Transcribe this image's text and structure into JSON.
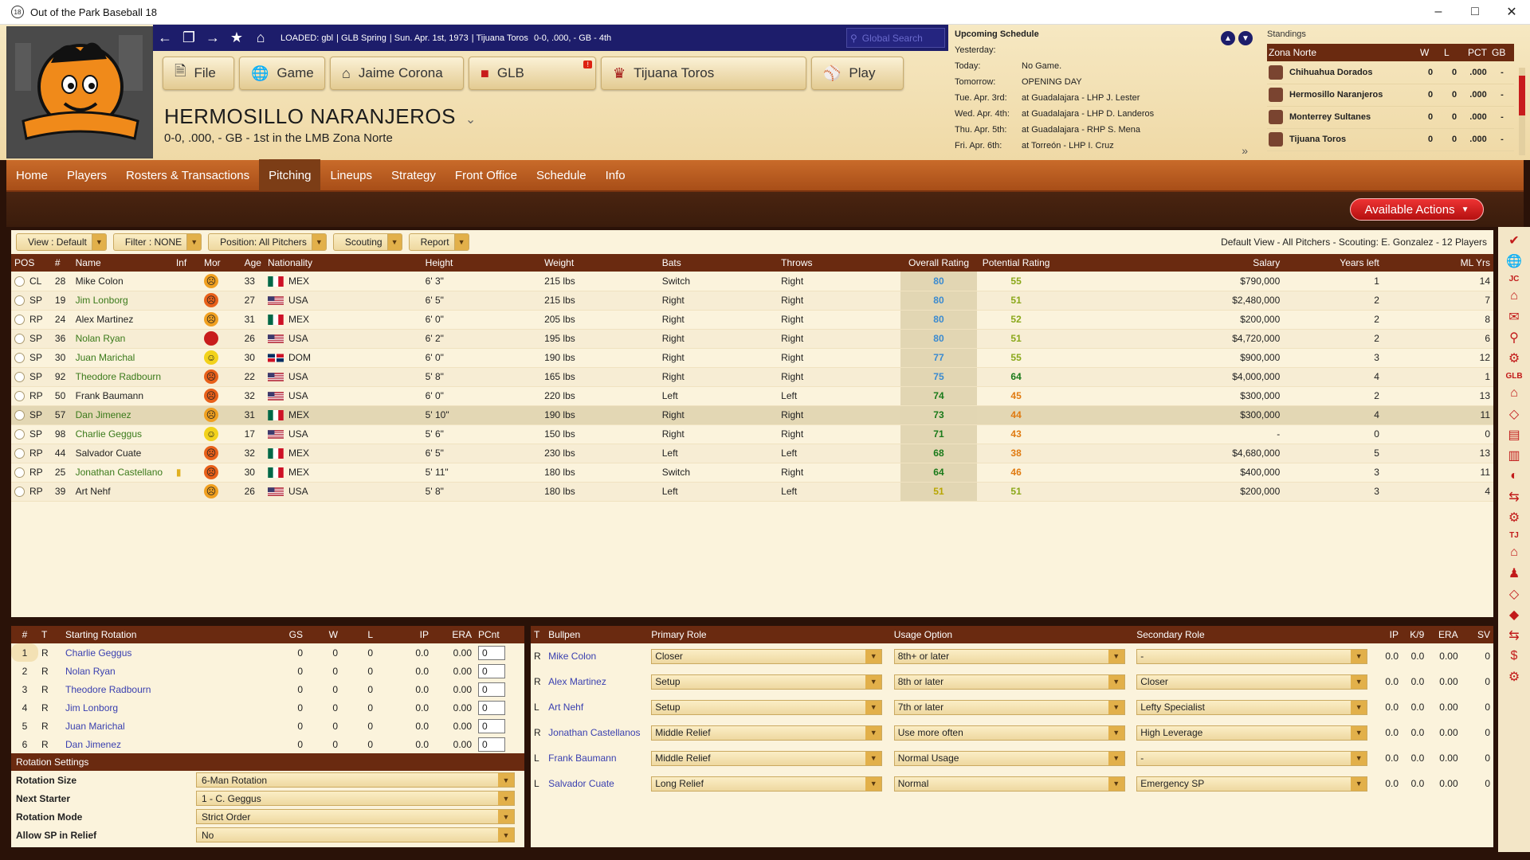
{
  "window": {
    "title": "Out of the Park Baseball 18",
    "icon_text": "18"
  },
  "navbar": {
    "loaded": "LOADED: gbl",
    "parts": [
      "GLB Spring",
      "Sun. Apr. 1st, 1973",
      "Tijuana Toros",
      "0-0, .000, - GB - 4th"
    ],
    "search_placeholder": "Global Search"
  },
  "main_menu": [
    {
      "label": "File",
      "icon": "file-icon"
    },
    {
      "label": "Game",
      "icon": "globe-icon"
    },
    {
      "label": "Jaime Corona",
      "icon": "home-icon"
    },
    {
      "label": "GLB",
      "icon": "league-icon",
      "badge": "!"
    },
    {
      "label": "Tijuana Toros",
      "icon": "team-logo-icon"
    },
    {
      "label": "Play",
      "icon": "baseball-icon"
    }
  ],
  "team": {
    "name": "HERMOSILLO NARANJEROS",
    "sub": "0-0, .000, - GB - 1st in the LMB Zona Norte"
  },
  "upcoming": {
    "header": "Upcoming Schedule",
    "rows": [
      {
        "d": "Yesterday:",
        "v": ""
      },
      {
        "d": "Today:",
        "v": "No Game."
      },
      {
        "d": "Tomorrow:",
        "v": "OPENING DAY"
      },
      {
        "d": "Tue. Apr. 3rd:",
        "v": "at Guadalajara - LHP J. Lester"
      },
      {
        "d": "Wed. Apr. 4th:",
        "v": "at Guadalajara - LHP D. Landeros"
      },
      {
        "d": "Thu. Apr. 5th:",
        "v": "at Guadalajara - RHP S. Mena"
      },
      {
        "d": "Fri. Apr. 6th:",
        "v": "at Torreón - LHP I. Cruz"
      }
    ]
  },
  "standings": {
    "header": "Standings",
    "cols": [
      "Zona Norte",
      "W",
      "L",
      "PCT",
      "GB"
    ],
    "rows": [
      {
        "team": "Chihuahua Dorados",
        "w": "0",
        "l": "0",
        "pct": ".000",
        "gb": "-"
      },
      {
        "team": "Hermosillo Naranjeros",
        "w": "0",
        "l": "0",
        "pct": ".000",
        "gb": "-"
      },
      {
        "team": "Monterrey  Sultanes",
        "w": "0",
        "l": "0",
        "pct": ".000",
        "gb": "-"
      },
      {
        "team": "Tijuana Toros",
        "w": "0",
        "l": "0",
        "pct": ".000",
        "gb": "-"
      }
    ]
  },
  "tabs": [
    "Home",
    "Players",
    "Rosters & Transactions",
    "Pitching",
    "Lineups",
    "Strategy",
    "Front Office",
    "Schedule",
    "Info"
  ],
  "active_tab": "Pitching",
  "available_actions": "Available Actions",
  "filters": [
    "View : Default",
    "Filter : NONE",
    "Position: All Pitchers",
    "Scouting",
    "Report"
  ],
  "view_info": "Default View - All Pitchers - Scouting: E. Gonzalez - 12 Players",
  "player_cols": [
    "POS",
    "#",
    "Name",
    "Inf",
    "Mor",
    "Age",
    "Nationality",
    "Height",
    "Weight",
    "Bats",
    "Throws",
    "Overall Rating",
    "Potential Rating",
    "Salary",
    "Years left",
    "ML Yrs"
  ],
  "players": [
    {
      "pos": "CL",
      "num": "28",
      "name": "Mike Colon",
      "link": false,
      "mood": "unhappy",
      "age": "33",
      "nat": "MEX",
      "ht": "6' 3\"",
      "wt": "215 lbs",
      "bats": "Switch",
      "throws": "Right",
      "ovr": "80",
      "pot": "55",
      "sal": "$790,000",
      "yl": "1",
      "ml": "14"
    },
    {
      "pos": "SP",
      "num": "19",
      "name": "Jim Lonborg",
      "link": true,
      "mood": "angry",
      "age": "27",
      "nat": "USA",
      "ht": "6' 5\"",
      "wt": "215 lbs",
      "bats": "Right",
      "throws": "Right",
      "ovr": "80",
      "pot": "51",
      "sal": "$2,480,000",
      "yl": "2",
      "ml": "7"
    },
    {
      "pos": "RP",
      "num": "24",
      "name": "Alex Martinez",
      "link": false,
      "mood": "unhappy",
      "age": "31",
      "nat": "MEX",
      "ht": "6' 0\"",
      "wt": "205 lbs",
      "bats": "Right",
      "throws": "Right",
      "ovr": "80",
      "pot": "52",
      "sal": "$200,000",
      "yl": "2",
      "ml": "8"
    },
    {
      "pos": "SP",
      "num": "36",
      "name": "Nolan Ryan",
      "link": true,
      "mood": "furious",
      "age": "26",
      "nat": "USA",
      "ht": "6' 2\"",
      "wt": "195 lbs",
      "bats": "Right",
      "throws": "Right",
      "ovr": "80",
      "pot": "51",
      "sal": "$4,720,000",
      "yl": "2",
      "ml": "6"
    },
    {
      "pos": "SP",
      "num": "30",
      "name": "Juan Marichal",
      "link": true,
      "mood": "happy",
      "age": "30",
      "nat": "DOM",
      "ht": "6' 0\"",
      "wt": "190 lbs",
      "bats": "Right",
      "throws": "Right",
      "ovr": "77",
      "pot": "55",
      "sal": "$900,000",
      "yl": "3",
      "ml": "12"
    },
    {
      "pos": "SP",
      "num": "92",
      "name": "Theodore Radbourn",
      "link": true,
      "mood": "angry",
      "age": "22",
      "nat": "USA",
      "ht": "5' 8\"",
      "wt": "165 lbs",
      "bats": "Right",
      "throws": "Right",
      "ovr": "75",
      "pot": "64",
      "sal": "$4,000,000",
      "yl": "4",
      "ml": "1"
    },
    {
      "pos": "RP",
      "num": "50",
      "name": "Frank Baumann",
      "link": false,
      "mood": "angry",
      "age": "32",
      "nat": "USA",
      "ht": "6' 0\"",
      "wt": "220 lbs",
      "bats": "Left",
      "throws": "Left",
      "ovr": "74",
      "pot": "45",
      "sal": "$300,000",
      "yl": "2",
      "ml": "13"
    },
    {
      "pos": "SP",
      "num": "57",
      "name": "Dan Jimenez",
      "link": true,
      "mood": "unhappy",
      "age": "31",
      "nat": "MEX",
      "ht": "5' 10\"",
      "wt": "190 lbs",
      "bats": "Right",
      "throws": "Right",
      "ovr": "73",
      "pot": "44",
      "sal": "$300,000",
      "yl": "4",
      "ml": "11",
      "selected": true
    },
    {
      "pos": "SP",
      "num": "98",
      "name": "Charlie Geggus",
      "link": true,
      "mood": "happy",
      "age": "17",
      "nat": "USA",
      "ht": "5' 6\"",
      "wt": "150 lbs",
      "bats": "Right",
      "throws": "Right",
      "ovr": "71",
      "pot": "43",
      "sal": "-",
      "yl": "0",
      "ml": "0"
    },
    {
      "pos": "RP",
      "num": "44",
      "name": "Salvador Cuate",
      "link": false,
      "mood": "angry",
      "age": "32",
      "nat": "MEX",
      "ht": "6' 5\"",
      "wt": "230 lbs",
      "bats": "Left",
      "throws": "Left",
      "ovr": "68",
      "pot": "38",
      "sal": "$4,680,000",
      "yl": "5",
      "ml": "13"
    },
    {
      "pos": "RP",
      "num": "25",
      "name": "Jonathan Castellano",
      "link": true,
      "inf": true,
      "mood": "angry",
      "age": "30",
      "nat": "MEX",
      "ht": "5' 11\"",
      "wt": "180 lbs",
      "bats": "Switch",
      "throws": "Right",
      "ovr": "64",
      "pot": "46",
      "sal": "$400,000",
      "yl": "3",
      "ml": "11"
    },
    {
      "pos": "RP",
      "num": "39",
      "name": "Art Nehf",
      "link": false,
      "mood": "unhappy",
      "age": "26",
      "nat": "USA",
      "ht": "5' 8\"",
      "wt": "180 lbs",
      "bats": "Left",
      "throws": "Left",
      "ovr": "51",
      "pot": "51",
      "sal": "$200,000",
      "yl": "3",
      "ml": "4"
    }
  ],
  "rotation_cols": [
    "#",
    "T",
    "Starting Rotation",
    "GS",
    "W",
    "L",
    "IP",
    "ERA",
    "PCnt"
  ],
  "rotation": [
    {
      "n": "1",
      "t": "R",
      "name": "Charlie Geggus",
      "gs": "0",
      "w": "0",
      "l": "0",
      "ip": "0.0",
      "era": "0.00",
      "pc": "0"
    },
    {
      "n": "2",
      "t": "R",
      "name": "Nolan Ryan",
      "gs": "0",
      "w": "0",
      "l": "0",
      "ip": "0.0",
      "era": "0.00",
      "pc": "0"
    },
    {
      "n": "3",
      "t": "R",
      "name": "Theodore Radbourn",
      "gs": "0",
      "w": "0",
      "l": "0",
      "ip": "0.0",
      "era": "0.00",
      "pc": "0"
    },
    {
      "n": "4",
      "t": "R",
      "name": "Jim Lonborg",
      "gs": "0",
      "w": "0",
      "l": "0",
      "ip": "0.0",
      "era": "0.00",
      "pc": "0"
    },
    {
      "n": "5",
      "t": "R",
      "name": "Juan Marichal",
      "gs": "0",
      "w": "0",
      "l": "0",
      "ip": "0.0",
      "era": "0.00",
      "pc": "0"
    },
    {
      "n": "6",
      "t": "R",
      "name": "Dan Jimenez",
      "gs": "0",
      "w": "0",
      "l": "0",
      "ip": "0.0",
      "era": "0.00",
      "pc": "0"
    }
  ],
  "rotation_settings": {
    "header": "Rotation Settings",
    "rows": [
      {
        "k": "Rotation Size",
        "v": "6-Man Rotation"
      },
      {
        "k": "Next Starter",
        "v": "1 - C. Geggus"
      },
      {
        "k": "Rotation Mode",
        "v": "Strict Order"
      },
      {
        "k": "Allow SP in Relief",
        "v": "No"
      }
    ]
  },
  "bullpen_cols": [
    "T",
    "Bullpen",
    "Primary Role",
    "Usage Option",
    "Secondary Role",
    "IP",
    "K/9",
    "ERA",
    "SV"
  ],
  "bullpen": [
    {
      "t": "R",
      "name": "Mike Colon",
      "role": "Closer",
      "usage": "8th+ or later",
      "sec": "-",
      "ip": "0.0",
      "k9": "0.0",
      "era": "0.00",
      "sv": "0"
    },
    {
      "t": "R",
      "name": "Alex Martinez",
      "role": "Setup",
      "usage": "8th or later",
      "sec": "Closer",
      "ip": "0.0",
      "k9": "0.0",
      "era": "0.00",
      "sv": "0"
    },
    {
      "t": "L",
      "name": "Art Nehf",
      "role": "Setup",
      "usage": "7th or later",
      "sec": "Lefty Specialist",
      "ip": "0.0",
      "k9": "0.0",
      "era": "0.00",
      "sv": "0"
    },
    {
      "t": "R",
      "name": "Jonathan Castellanos",
      "role": "Middle Relief",
      "usage": "Use more often",
      "sec": "High Leverage",
      "ip": "0.0",
      "k9": "0.0",
      "era": "0.00",
      "sv": "0"
    },
    {
      "t": "L",
      "name": "Frank Baumann",
      "role": "Middle Relief",
      "usage": "Normal Usage",
      "sec": "-",
      "ip": "0.0",
      "k9": "0.0",
      "era": "0.00",
      "sv": "0"
    },
    {
      "t": "L",
      "name": "Salvador Cuate",
      "role": "Long Relief",
      "usage": "Normal",
      "sec": "Emergency SP",
      "ip": "0.0",
      "k9": "0.0",
      "era": "0.00",
      "sv": "0"
    }
  ],
  "sidebar_labels": [
    "JC",
    "GLB",
    "TJ"
  ],
  "colors": {
    "navy": "#1d1d6b",
    "brown": "#6a2a10",
    "tab": "#c96b2a",
    "red": "#c81c1c",
    "ovr_blue": "#3a8ad0",
    "ovr_green": "#1a7a1a",
    "ovr_yellow": "#b8a600",
    "pot_green": "#8aa81a",
    "pot_orange": "#e07a10"
  }
}
